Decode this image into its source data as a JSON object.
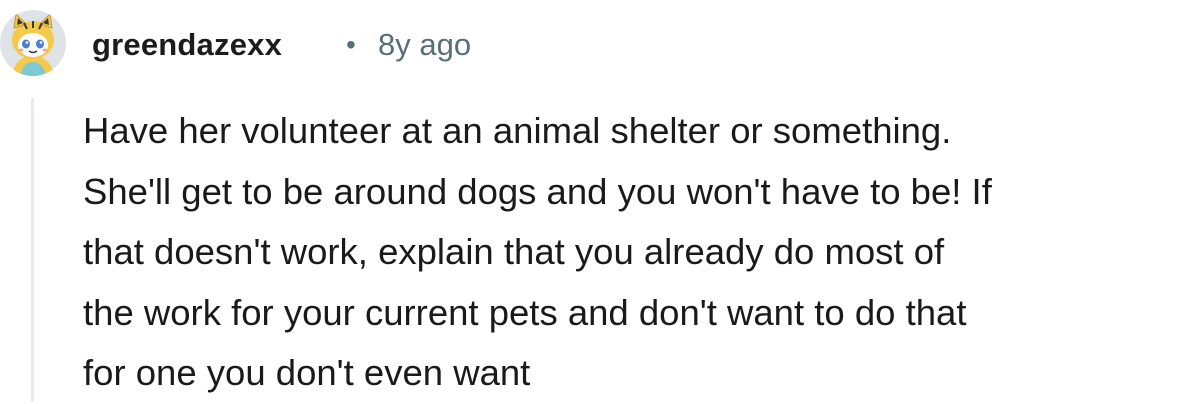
{
  "comment": {
    "author": "greendazexx",
    "separator": "•",
    "timestamp": "8y ago",
    "avatar_icon": "snoo-avatar-icon",
    "body": "Have her volunteer at an animal shelter or something.\nShe'll get to be around dogs and you won't have to be! If\nthat doesn't work, explain that you already do most of\nthe work for your current pets and don't want to do that\nfor one you don't even want"
  },
  "colors": {
    "author": "#1c1c1c",
    "meta": "#576f76",
    "body": "#1a1a1b",
    "thread_line": "#e5ebee",
    "avatar_bg": "#dde3e6",
    "avatar_yellow": "#f5c94a",
    "avatar_blue": "#7ec8d8"
  }
}
